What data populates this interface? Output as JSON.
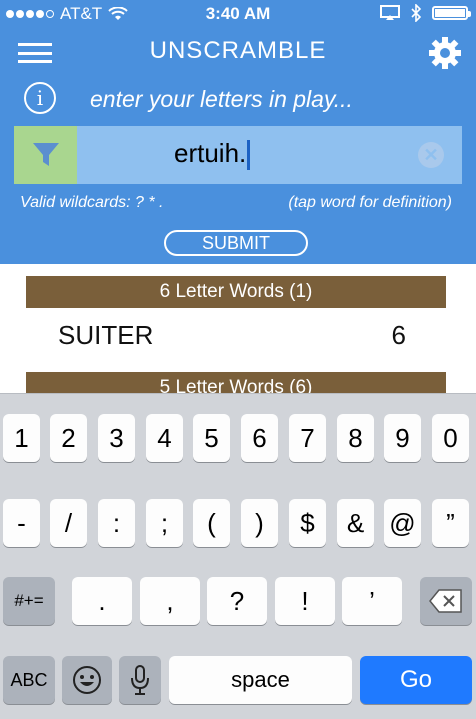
{
  "status": {
    "carrier": "AT&T",
    "time": "3:40 AM"
  },
  "header": {
    "title": "UNSCRAMBLE"
  },
  "search": {
    "hint": "enter your letters in play...",
    "value": "ertuih."
  },
  "help": {
    "wildcards": "Valid wildcards:  ?    *    .",
    "definition": "(tap word for definition)"
  },
  "submit_label": "SUBMIT",
  "results": {
    "sections": [
      {
        "header": "6 Letter Words (1)",
        "words": [
          {
            "word": "SUITER",
            "score": "6"
          }
        ]
      },
      {
        "header": "5 Letter Words (6)",
        "words": []
      }
    ]
  },
  "keyboard": {
    "row1": [
      "1",
      "2",
      "3",
      "4",
      "5",
      "6",
      "7",
      "8",
      "9",
      "0"
    ],
    "row2": [
      "-",
      "/",
      ":",
      ";",
      "(",
      ")",
      "$",
      "&",
      "@",
      "”"
    ],
    "row3": [
      ".",
      ",",
      "?",
      "!",
      "’"
    ],
    "mode_label": "#+=",
    "abc_label": "ABC",
    "space_label": "space",
    "go_label": "Go"
  },
  "colors": {
    "header_blue": "#4a90dd",
    "section_brown": "#7a5f3a",
    "go_blue": "#1f7aff"
  },
  "icons": {
    "menu": "hamburger-icon",
    "settings": "gear-icon",
    "info": "info-icon",
    "filter": "funnel-icon",
    "clear": "clear-icon",
    "emoji": "emoji-icon",
    "mic": "microphone-icon",
    "backspace": "backspace-icon"
  }
}
